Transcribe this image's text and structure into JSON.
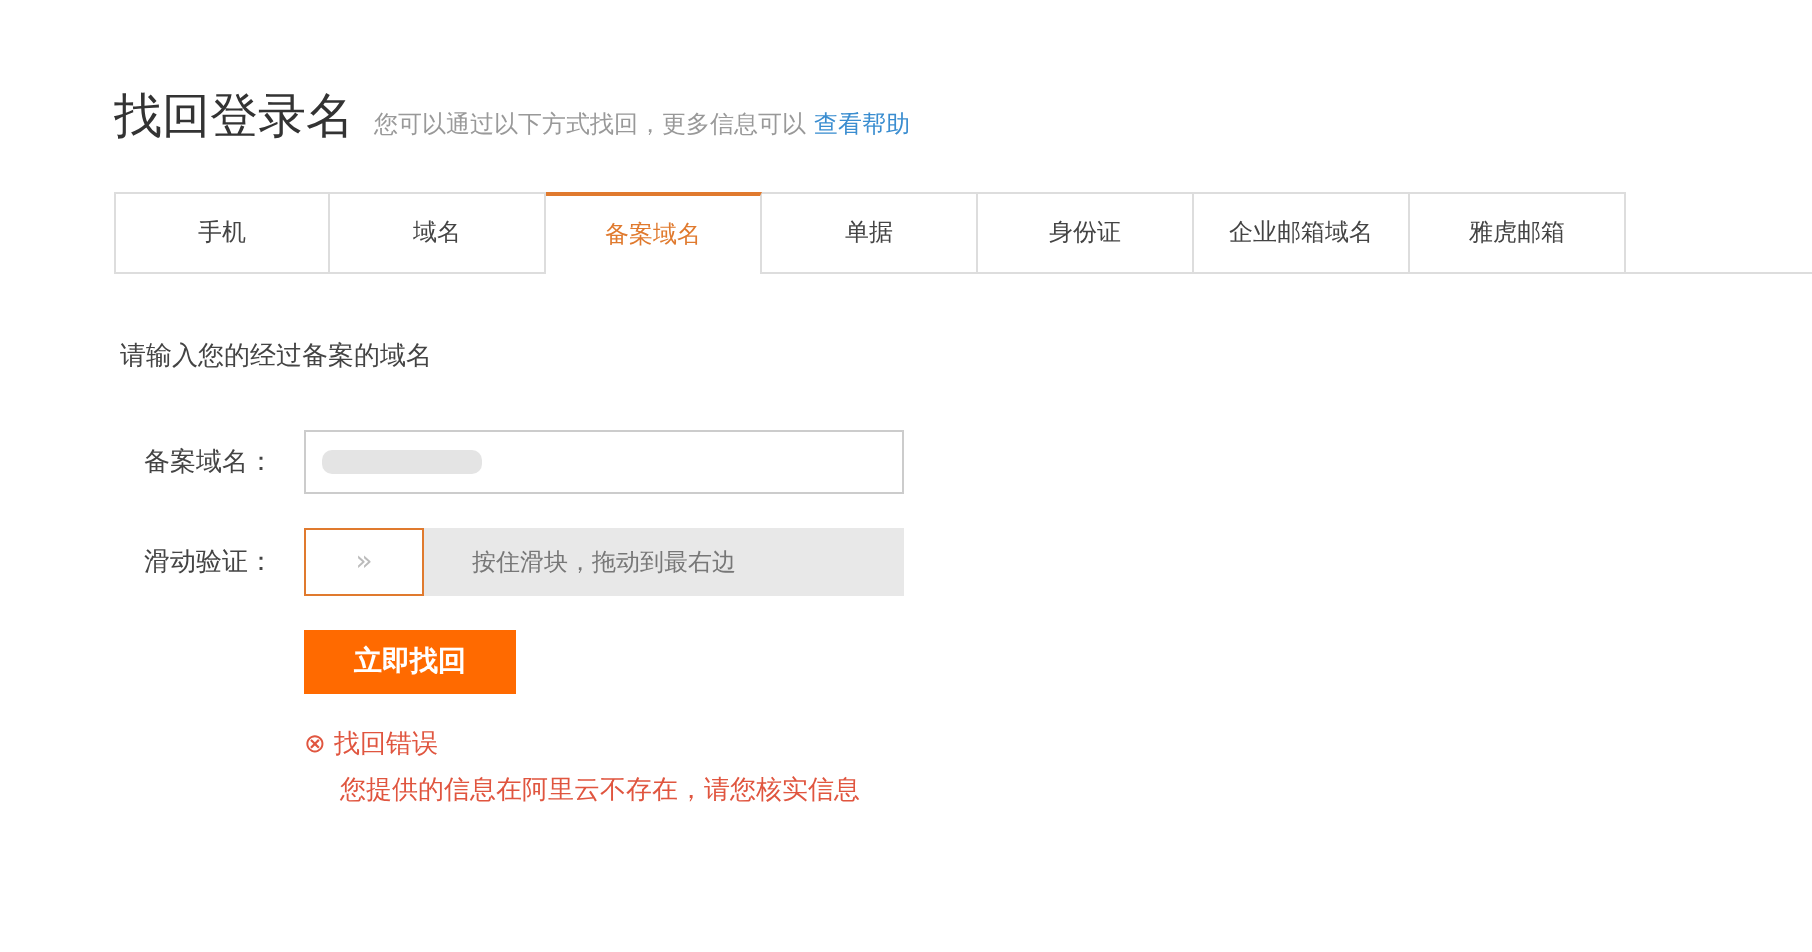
{
  "header": {
    "title": "找回登录名",
    "subtitle": "您可以通过以下方式找回，更多信息可以",
    "help_link": "查看帮助"
  },
  "tabs": [
    {
      "label": "手机",
      "selected": false
    },
    {
      "label": "域名",
      "selected": false
    },
    {
      "label": "备案域名",
      "selected": true
    },
    {
      "label": "单据",
      "selected": false
    },
    {
      "label": "身份证",
      "selected": false
    },
    {
      "label": "企业邮箱域名",
      "selected": false
    },
    {
      "label": "雅虎邮箱",
      "selected": false
    }
  ],
  "prompt": "请输入您的经过备案的域名",
  "form": {
    "domain_label": "备案域名：",
    "slider_label": "滑动验证：",
    "slider": {
      "handle": "»",
      "hint": "按住滑块，拖动到最右边",
      "level": 0
    }
  },
  "submit": "立即找回",
  "error": {
    "icon": "⊗",
    "title": "找回错误",
    "message": "您提供的信息在阿里云不存在，请您核实信息"
  }
}
